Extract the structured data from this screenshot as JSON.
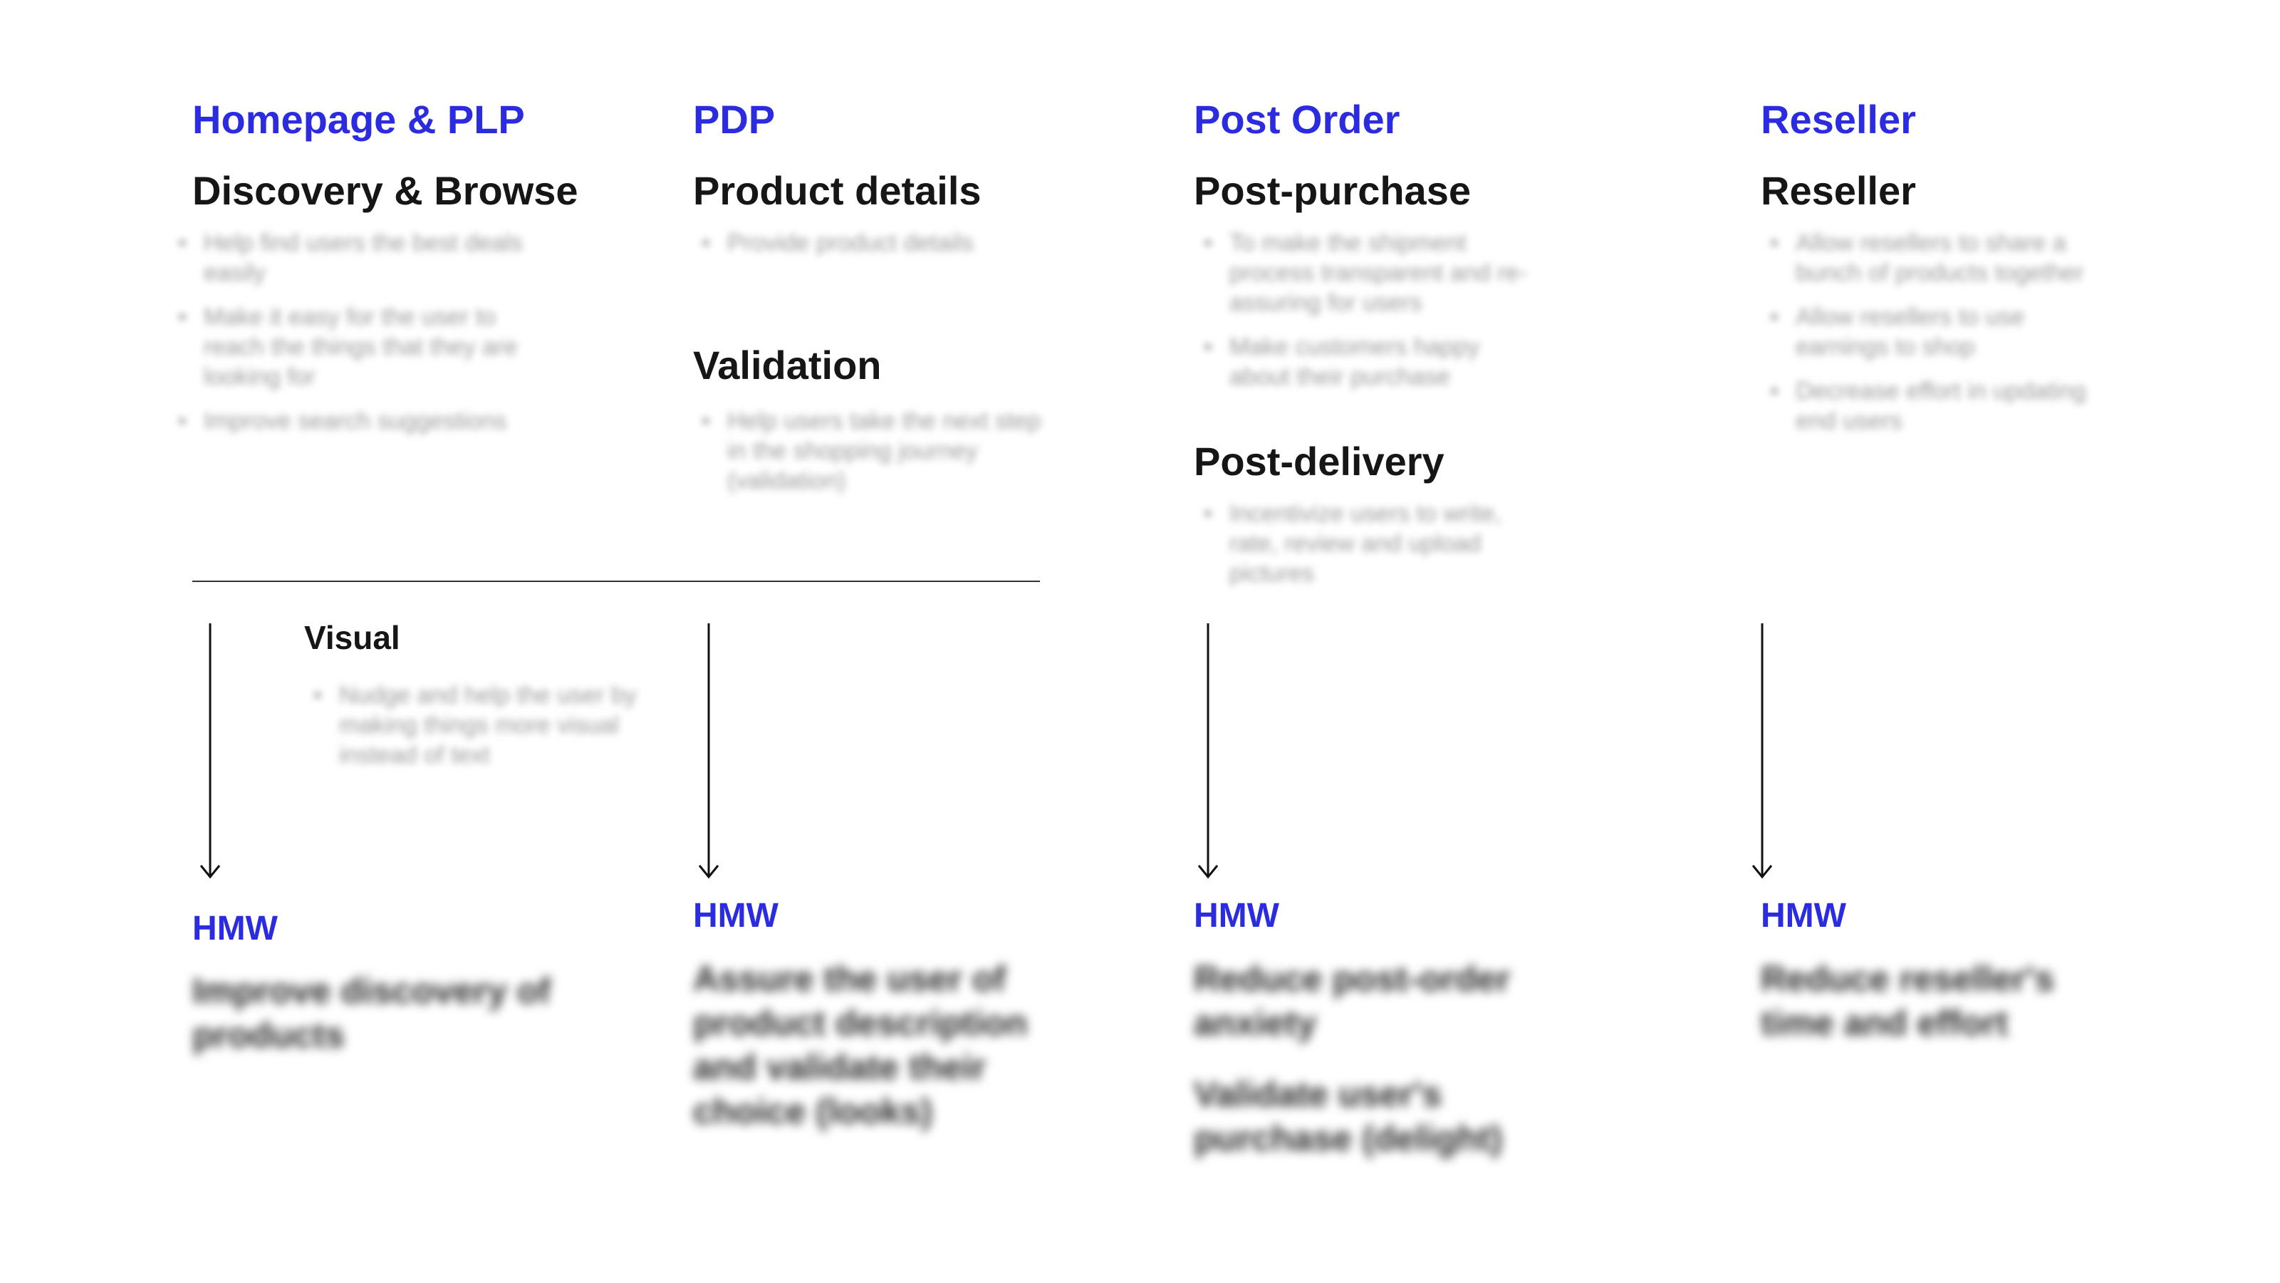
{
  "columns": [
    {
      "stage": "Homepage & PLP",
      "phases": [
        {
          "title": "Discovery & Browse",
          "bullets": [
            "Help find users the best deals easily",
            "Make it easy for the user to reach the things that they are looking for",
            "Improve search suggestions"
          ]
        }
      ],
      "extra": {
        "title": "Visual",
        "bullets": [
          "Nudge and help the user by making things more visual instead of text"
        ]
      },
      "hmw_label": "HMW",
      "hmw": [
        "Improve discovery of products"
      ]
    },
    {
      "stage": "PDP",
      "phases": [
        {
          "title": "Product details",
          "bullets": [
            "Provide product details"
          ]
        },
        {
          "title": "Validation",
          "bullets": [
            "Help users take the next step in the shopping journey (validation)"
          ]
        }
      ],
      "hmw_label": "HMW",
      "hmw": [
        "Assure the user of product description and validate their choice (looks)"
      ]
    },
    {
      "stage": "Post Order",
      "phases": [
        {
          "title": "Post-purchase",
          "bullets": [
            "To make the shipment process transparent and re-assuring for users",
            "Make customers happy about their purchase"
          ]
        },
        {
          "title": "Post-delivery",
          "bullets": [
            "Incentivize users to write, rate, review and upload pictures"
          ]
        }
      ],
      "hmw_label": "HMW",
      "hmw": [
        "Reduce post-order anxiety",
        "Validate user's purchase (delight)"
      ]
    },
    {
      "stage": "Reseller",
      "phases": [
        {
          "title": "Reseller",
          "bullets": [
            "Allow resellers to share a bunch of products together",
            "Allow resellers to use earnings to shop",
            "Decrease effort in updating end users"
          ]
        }
      ],
      "hmw_label": "HMW",
      "hmw": [
        "Reduce reseller's time and effort"
      ]
    }
  ]
}
